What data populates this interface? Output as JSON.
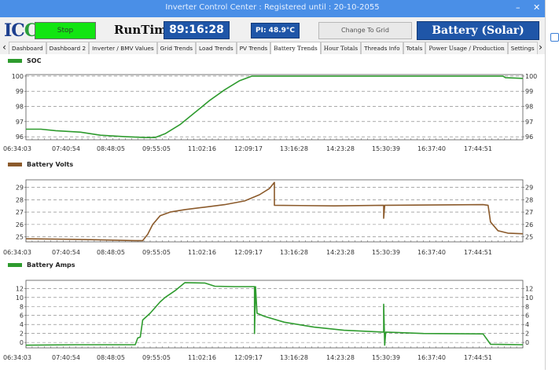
{
  "window": {
    "title": "Inverter Control Center : Registered until : 20-10-2055",
    "min_glyph": "–",
    "close_glyph": "✕"
  },
  "toolbar": {
    "logo_primary": "IC",
    "logo_secondary": "C",
    "stop_label": "Stop",
    "runtime_label": "RunTime",
    "runtime_value": "89:16:28",
    "temperature": "PI: 48.9°C",
    "grid_button": "Change To Grid",
    "battery_button": "Battery (Solar)"
  },
  "tabs": [
    {
      "label": "Dashboard"
    },
    {
      "label": "Dashboard 2"
    },
    {
      "label": "Inverter / BMV Values"
    },
    {
      "label": "Grid Trends"
    },
    {
      "label": "Load Trends"
    },
    {
      "label": "PV Trends"
    },
    {
      "label": "Battery Trends",
      "active": true
    },
    {
      "label": "Hour Totals"
    },
    {
      "label": "Threads Info"
    },
    {
      "label": "Totals"
    },
    {
      "label": "Power Usage / Production"
    },
    {
      "label": "Settings"
    }
  ],
  "tab_arrows": {
    "left": "‹",
    "right": "›"
  },
  "colors": {
    "green": "#2e9b2e",
    "brown": "#8b5a2b",
    "accent": "#1f56a8",
    "stop": "#12e512"
  },
  "chart_data": [
    {
      "type": "line",
      "title": "SOC",
      "color": "#2e9b2e",
      "x": [
        "06:34:03",
        "07:40:54",
        "08:48:05",
        "09:55:05",
        "11:02:16",
        "12:09:17",
        "13:16:28",
        "14:23:28",
        "15:30:39",
        "16:37:40",
        "17:44:51"
      ],
      "yticks": [
        96,
        97,
        98,
        99,
        100
      ],
      "ylim": [
        95.8,
        100.1
      ],
      "points": [
        [
          0,
          96.5
        ],
        [
          0.03,
          96.5
        ],
        [
          0.06,
          96.4
        ],
        [
          0.11,
          96.3
        ],
        [
          0.15,
          96.1
        ],
        [
          0.2,
          96.0
        ],
        [
          0.24,
          95.95
        ],
        [
          0.26,
          95.95
        ],
        [
          0.28,
          96.2
        ],
        [
          0.31,
          96.8
        ],
        [
          0.34,
          97.6
        ],
        [
          0.37,
          98.4
        ],
        [
          0.4,
          99.1
        ],
        [
          0.43,
          99.7
        ],
        [
          0.455,
          100
        ],
        [
          0.96,
          100
        ],
        [
          0.965,
          99.9
        ],
        [
          1,
          99.85
        ]
      ]
    },
    {
      "type": "line",
      "title": "Battery Volts",
      "color": "#8b5a2b",
      "x": [
        "06:34:03",
        "07:40:54",
        "08:48:05",
        "09:55:05",
        "11:02:16",
        "12:09:17",
        "13:16:28",
        "14:23:28",
        "15:30:39",
        "16:37:40",
        "17:44:51"
      ],
      "yticks": [
        25,
        26,
        27,
        28,
        29
      ],
      "ylim": [
        24.6,
        29.6
      ],
      "points": [
        [
          0,
          24.85
        ],
        [
          0.1,
          24.8
        ],
        [
          0.22,
          24.7
        ],
        [
          0.235,
          24.7
        ],
        [
          0.245,
          25.2
        ],
        [
          0.255,
          26.0
        ],
        [
          0.27,
          26.7
        ],
        [
          0.29,
          27.0
        ],
        [
          0.32,
          27.2
        ],
        [
          0.36,
          27.4
        ],
        [
          0.4,
          27.6
        ],
        [
          0.44,
          27.9
        ],
        [
          0.47,
          28.4
        ],
        [
          0.49,
          28.9
        ],
        [
          0.5,
          29.4
        ],
        [
          0.5,
          27.55
        ],
        [
          0.62,
          27.5
        ],
        [
          0.72,
          27.55
        ],
        [
          0.72,
          26.5
        ],
        [
          0.722,
          27.55
        ],
        [
          0.92,
          27.6
        ],
        [
          0.93,
          27.55
        ],
        [
          0.935,
          26.2
        ],
        [
          0.95,
          25.5
        ],
        [
          0.97,
          25.3
        ],
        [
          1,
          25.25
        ]
      ]
    },
    {
      "type": "line",
      "title": "Battery Amps",
      "color": "#2e9b2e",
      "x": [
        "06:34:03",
        "07:40:54",
        "08:48:05",
        "09:55:05",
        "11:02:16",
        "12:09:17",
        "13:16:28",
        "14:23:28",
        "15:30:39",
        "16:37:40",
        "17:44:51"
      ],
      "yticks": [
        0,
        2,
        4,
        6,
        8,
        10,
        12
      ],
      "ylim": [
        -1.2,
        13.8
      ],
      "points": [
        [
          0,
          -0.6
        ],
        [
          0.1,
          -0.5
        ],
        [
          0.22,
          -0.5
        ],
        [
          0.225,
          1.0
        ],
        [
          0.23,
          1.2
        ],
        [
          0.235,
          5.0
        ],
        [
          0.25,
          6.5
        ],
        [
          0.27,
          9.0
        ],
        [
          0.28,
          10.0
        ],
        [
          0.3,
          11.5
        ],
        [
          0.32,
          13.3
        ],
        [
          0.36,
          13.2
        ],
        [
          0.38,
          12.5
        ],
        [
          0.42,
          12.4
        ],
        [
          0.46,
          12.4
        ],
        [
          0.46,
          2.0
        ],
        [
          0.462,
          12.4
        ],
        [
          0.465,
          6.5
        ],
        [
          0.48,
          5.8
        ],
        [
          0.52,
          4.5
        ],
        [
          0.58,
          3.4
        ],
        [
          0.64,
          2.7
        ],
        [
          0.72,
          2.3
        ],
        [
          0.72,
          8.5
        ],
        [
          0.722,
          -0.6
        ],
        [
          0.724,
          2.3
        ],
        [
          0.8,
          2.0
        ],
        [
          0.92,
          1.9
        ],
        [
          0.935,
          -0.4
        ],
        [
          1,
          -0.5
        ]
      ]
    }
  ]
}
